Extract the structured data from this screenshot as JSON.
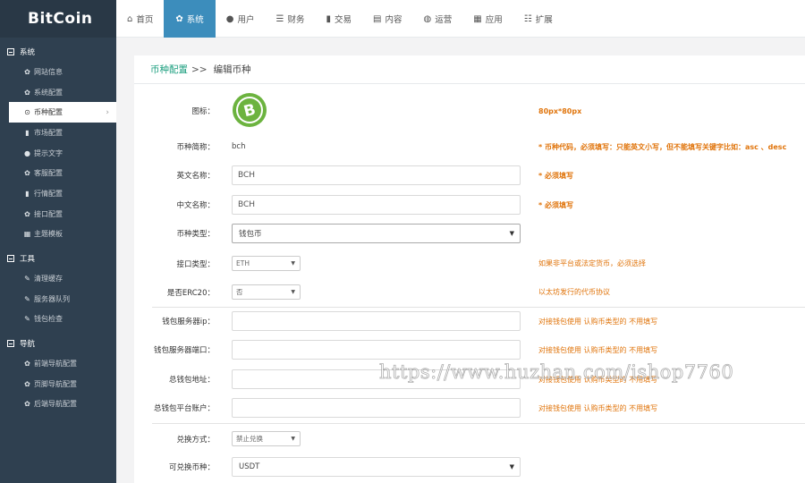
{
  "app": {
    "logo": "BitCoin"
  },
  "topnav": [
    {
      "label": "首页",
      "icon": "home-icon",
      "glyph": "⌂"
    },
    {
      "label": "系统",
      "icon": "gear-icon",
      "glyph": "✿"
    },
    {
      "label": "用户",
      "icon": "user-icon",
      "glyph": "●"
    },
    {
      "label": "财务",
      "icon": "list-icon",
      "glyph": "☰"
    },
    {
      "label": "交易",
      "icon": "bar-chart-icon",
      "glyph": "▮"
    },
    {
      "label": "内容",
      "icon": "document-icon",
      "glyph": "▤"
    },
    {
      "label": "运营",
      "icon": "globe-icon",
      "glyph": "◍"
    },
    {
      "label": "应用",
      "icon": "grid-icon",
      "glyph": "▦"
    },
    {
      "label": "扩展",
      "icon": "tasks-icon",
      "glyph": "☷"
    }
  ],
  "sidebar": {
    "groups": [
      {
        "title": "系统",
        "items": [
          {
            "label": "网站信息",
            "glyph": "✿"
          },
          {
            "label": "系统配置",
            "glyph": "✿"
          },
          {
            "label": "币种配置",
            "glyph": "⊙"
          },
          {
            "label": "市场配置",
            "glyph": "▮"
          },
          {
            "label": "提示文字",
            "glyph": "●"
          },
          {
            "label": "客服配置",
            "glyph": "✿"
          },
          {
            "label": "行情配置",
            "glyph": "▮"
          },
          {
            "label": "接口配置",
            "glyph": "✿"
          },
          {
            "label": "主题模板",
            "glyph": "▦"
          }
        ]
      },
      {
        "title": "工具",
        "items": [
          {
            "label": "清理缓存",
            "glyph": "✎"
          },
          {
            "label": "服务器队列",
            "glyph": "✎"
          },
          {
            "label": "钱包检查",
            "glyph": "✎"
          }
        ]
      },
      {
        "title": "导航",
        "items": [
          {
            "label": "前端导航配置",
            "glyph": "✿"
          },
          {
            "label": "页脚导航配置",
            "glyph": "✿"
          },
          {
            "label": "后端导航配置",
            "glyph": "✿"
          }
        ]
      }
    ],
    "active_chevron": "›"
  },
  "breadcrumb": {
    "parent": "币种配置",
    "separator": ">>",
    "current": "编辑币种"
  },
  "form": {
    "icon": {
      "label": "图标：",
      "hint": "80px*80px",
      "image": "bitcoin-cash-logo-icon"
    },
    "code": {
      "label": "币种简称：",
      "value": "bch",
      "hint": "* 币种代码，必须填写：只能英文小写，但不能填写关键字比如：asc 、desc"
    },
    "en_name": {
      "label": "英文名称：",
      "value": "BCH",
      "hint": "* 必须填写"
    },
    "cn_name": {
      "label": "中文名称：",
      "value": "BCH",
      "hint": "* 必须填写"
    },
    "type": {
      "label": "币种类型：",
      "value": "钱包币",
      "arrow": "▼"
    },
    "interface": {
      "label": "接口类型：",
      "value": "ETH",
      "arrow": "▼",
      "hint": "如果非平台或法定货币，必须选择"
    },
    "erc20": {
      "label": "是否ERC20：",
      "value": "否",
      "arrow": "▼",
      "hint": "以太坊发行的代币协议"
    },
    "wallet_ip": {
      "label": "钱包服务器ip：",
      "value": "",
      "hint": "对接钱包使用 认购币类型的 不用填写"
    },
    "wallet_port": {
      "label": "钱包服务器端口：",
      "value": "",
      "hint": "对接钱包使用 认购币类型的 不用填写"
    },
    "wallet_addr": {
      "label": "总钱包地址：",
      "value": "",
      "hint": "对接钱包使用 认购币类型的 不用填写"
    },
    "wallet_account": {
      "label": "总钱包平台账户：",
      "value": "",
      "hint": "对接钱包使用 认购币类型的 不用填写"
    },
    "exchange_mode": {
      "label": "兑换方式：",
      "value": "禁止兑换",
      "arrow": "▼"
    },
    "exchange_coin": {
      "label": "可兑换币种：",
      "value": "USDT",
      "arrow": "▼"
    }
  },
  "watermark": "https://www.huzhan.com/ishop7760",
  "colors": {
    "sidebar": "#2f4050",
    "active_nav": "#3c8dbc",
    "hint": "#e0740b",
    "link": "#1a9e7e",
    "coin": "#6cb33f"
  }
}
